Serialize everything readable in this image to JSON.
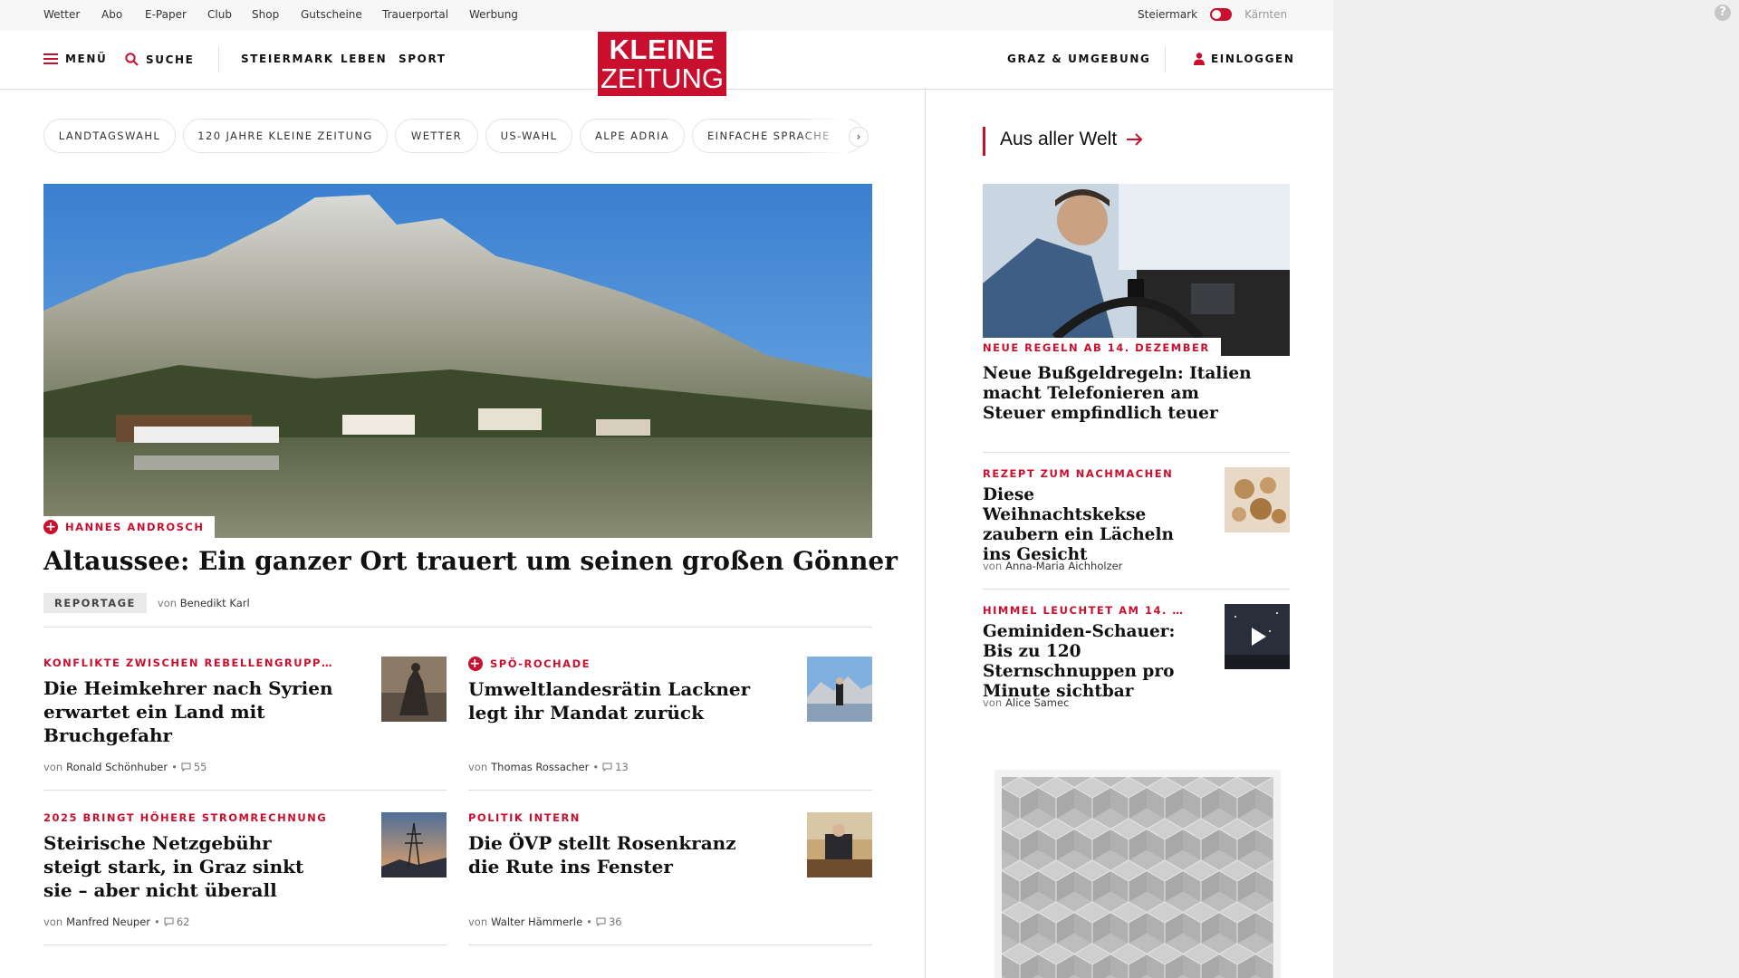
{
  "utility_bar": {
    "links": [
      "Wetter",
      "Abo",
      "E-Paper",
      "Club",
      "Shop",
      "Gutscheine",
      "Trauerportal",
      "Werbung"
    ],
    "region_active": "Steiermark",
    "region_inactive": "Kärnten"
  },
  "nav": {
    "menu": "MENÜ",
    "search": "SUCHE",
    "sections": [
      "STEIERMARK",
      "LEBEN",
      "SPORT"
    ],
    "local": "GRAZ & UMGEBUNG",
    "login": "EINLOGGEN"
  },
  "logo": {
    "line1": "KLEINE",
    "line2": "ZEITUNG",
    "color": "#c8102e"
  },
  "topics": [
    "LANDTAGSWAHL",
    "120 JAHRE KLEINE ZEITUNG",
    "WETTER",
    "US-WAHL",
    "ALPE ADRIA",
    "EINFACHE SPRACHE"
  ],
  "topics_next": "›",
  "hero": {
    "kicker": "HANNES ANDROSCH",
    "title": "Altaussee: Ein ganzer Ort trauert um seinen großen Gönner",
    "badge": "REPORTAGE",
    "by": "von",
    "author": "Benedikt Karl"
  },
  "teasers": [
    {
      "kicker": "KONFLIKTE ZWISCHEN REBELLENGRUPP…",
      "plus": false,
      "title": "Die Heimkehrer nach Syrien erwartet ein Land mit Bruchgefahr",
      "by": "von",
      "author": "Ronald Schönhuber",
      "comments": "55"
    },
    {
      "kicker": "SPÖ-ROCHADE",
      "plus": true,
      "title": "Umweltlandesrätin Lackner legt ihr Mandat zurück",
      "by": "von",
      "author": "Thomas Rossacher",
      "comments": "13"
    },
    {
      "kicker": "2025 BRINGT HÖHERE STROMRECHNUNG",
      "plus": false,
      "title": "Steirische Netzgebühr steigt stark, in Graz sinkt sie – aber nicht überall",
      "by": "von",
      "author": "Manfred Neuper",
      "comments": "62"
    },
    {
      "kicker": "POLITIK INTERN",
      "plus": false,
      "title": "Die ÖVP stellt Rosenkranz die Rute ins Fenster",
      "by": "von",
      "author": "Walter Hämmerle",
      "comments": "36"
    }
  ],
  "sidebar": {
    "section_title": "Aus aller Welt",
    "lead": {
      "kicker": "NEUE REGELN AB 14. DEZEMBER",
      "title": "Neue Bußgeldregeln: Italien macht Telefonieren am Steuer empfindlich teuer"
    },
    "items": [
      {
        "kicker": "REZEPT ZUM NACHMACHEN",
        "title": "Diese Weihnachtskekse zaubern ein Lächeln ins Gesicht",
        "by": "von",
        "author": "Anna-Maria Aichholzer"
      },
      {
        "kicker": "HIMMEL LEUCHTET AM 14. …",
        "title": "Geminiden-Schauer: Bis zu 120 Sternschnuppen pro Minute sichtbar",
        "by": "von",
        "author": "Alice Samec"
      }
    ]
  },
  "help_icon": "?"
}
